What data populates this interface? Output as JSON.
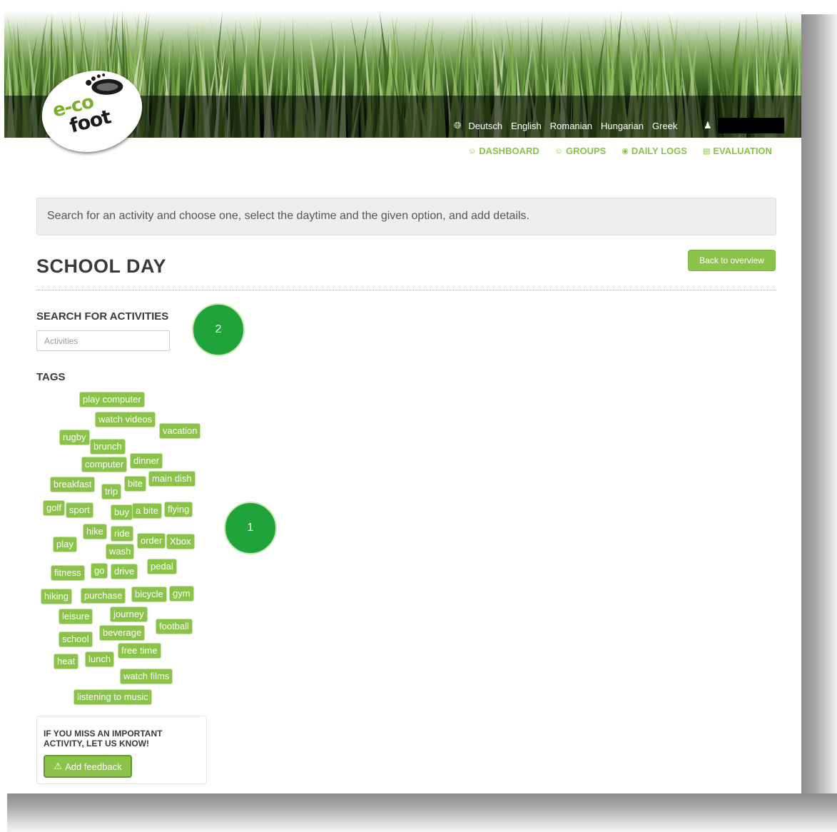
{
  "header": {
    "logo_line1": "e-co",
    "logo_line2": "foot",
    "languages": [
      "Deutsch",
      "English",
      "Romanian",
      "Hungarian",
      "Greek"
    ],
    "icons": {
      "language": "globe-icon",
      "user": "user-icon"
    }
  },
  "nav": {
    "dashboard": "DASHBOARD",
    "groups": "GROUPS",
    "daily_logs": "DAILY LOGS",
    "evaluation": "EVALUATION"
  },
  "info": "Search for an activity and choose one, select the daytime and the given option, and add details.",
  "page_title": "SCHOOL DAY",
  "back_button": "Back to overview",
  "search": {
    "label": "SEARCH FOR ACTIVITIES",
    "placeholder": "Activities"
  },
  "tags_label": "TAGS",
  "tags": [
    "play computer",
    "watch videos",
    "vacation",
    "rugby",
    "brunch",
    "computer",
    "dinner",
    "breakfast",
    "trip",
    "bite",
    "main dish",
    "golf",
    "sport",
    "buy",
    "a bite",
    "flying",
    "hike",
    "ride",
    "play",
    "order",
    "Xbox",
    "wash",
    "fitness",
    "go",
    "drive",
    "pedal",
    "hiking",
    "purchase",
    "bicycle",
    "gym",
    "leisure",
    "journey",
    "football",
    "school",
    "beverage",
    "heat",
    "lunch",
    "free time",
    "watch films",
    "listening to music"
  ],
  "markers": {
    "one": "1",
    "two": "2"
  },
  "feedback": {
    "text": "IF YOU MISS AN IMPORTANT ACTIVITY, LET US KNOW!",
    "button": "Add feedback"
  },
  "colors": {
    "accent": "#8bc34a",
    "marker": "#1fa33a"
  }
}
